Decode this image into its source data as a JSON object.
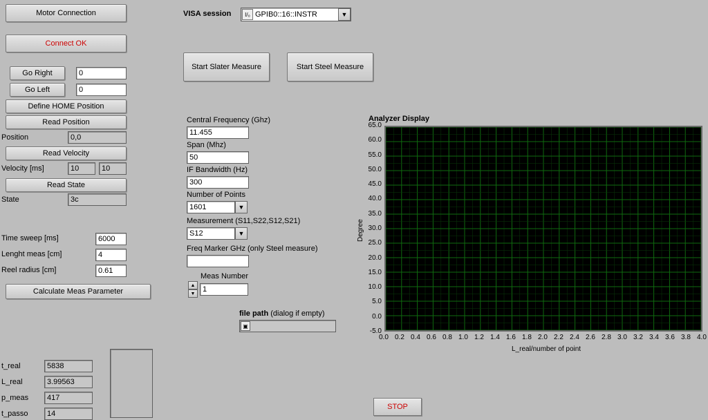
{
  "header": {
    "visa_session_label": "VISA session",
    "visa_session_value": "GPIB0::16::INSTR"
  },
  "motor": {
    "motor_connection": "Motor Connection",
    "connect_ok": "Connect OK",
    "go_right": "Go Right",
    "go_right_value": "0",
    "go_left": "Go Left",
    "go_left_value": "0",
    "define_home": "Define HOME Position",
    "read_position": "Read Position",
    "position_label": "Position",
    "position_value": "0,0",
    "read_velocity": "Read Velocity",
    "velocity_label": "Velocity [ms]",
    "velocity_value1": "10",
    "velocity_value2": "10",
    "read_state": "Read State",
    "state_label": "State",
    "state_value": "3c"
  },
  "sweep": {
    "time_sweep_label": "Time sweep [ms]",
    "time_sweep_value": "6000",
    "length_meas_label": "Lenght meas [cm]",
    "length_meas_value": "4",
    "reel_radius_label": "Reel radius [cm]",
    "reel_radius_value": "0.61",
    "calc_button": "Calculate Meas Parameter"
  },
  "results": {
    "t_real_label": "t_real",
    "t_real_value": "5838",
    "L_real_label": "L_real",
    "L_real_value": "3.99563",
    "p_meas_label": "p_meas",
    "p_meas_value": "417",
    "t_passo_label": "t_passo",
    "t_passo_value": "14"
  },
  "measure": {
    "start_slater": "Start Slater Measure",
    "start_steel": "Start Steel Measure",
    "central_freq_label": "Central Frequency (Ghz)",
    "central_freq_value": "11.455",
    "span_label": "Span (Mhz)",
    "span_value": "50",
    "if_bw_label": "IF Bandwidth (Hz)",
    "if_bw_value": "300",
    "num_points_label": "Number of Points",
    "num_points_value": "1601",
    "measurement_label": "Measurement (S11,S22,S12,S21)",
    "measurement_value": "S12",
    "freq_marker_label": "Freq Marker GHz (only Steel measure)",
    "freq_marker_value": "",
    "meas_number_label": "Meas Number",
    "meas_number_value": "1",
    "file_path_label_prefix": "file path ",
    "file_path_label_suffix": "(dialog if empty)"
  },
  "plot": {
    "title": "Analyzer Display",
    "ylabel": "Degree",
    "xlabel": "L_real/number of point",
    "yticks": [
      "65.0",
      "60.0",
      "55.0",
      "50.0",
      "45.0",
      "40.0",
      "35.0",
      "30.0",
      "25.0",
      "20.0",
      "15.0",
      "10.0",
      "5.0",
      "0.0",
      "-5.0"
    ],
    "xticks": [
      "0.0",
      "0.2",
      "0.4",
      "0.6",
      "0.8",
      "1.0",
      "1.2",
      "1.4",
      "1.6",
      "1.8",
      "2.0",
      "2.2",
      "2.4",
      "2.6",
      "2.8",
      "3.0",
      "3.2",
      "3.4",
      "3.6",
      "3.8",
      "4.0"
    ]
  },
  "stop": "STOP",
  "chart_data": {
    "type": "line",
    "title": "Analyzer Display",
    "xlabel": "L_real/number of point",
    "ylabel": "Degree",
    "xlim": [
      0.0,
      4.0
    ],
    "ylim": [
      -5.0,
      65.0
    ],
    "series": []
  }
}
